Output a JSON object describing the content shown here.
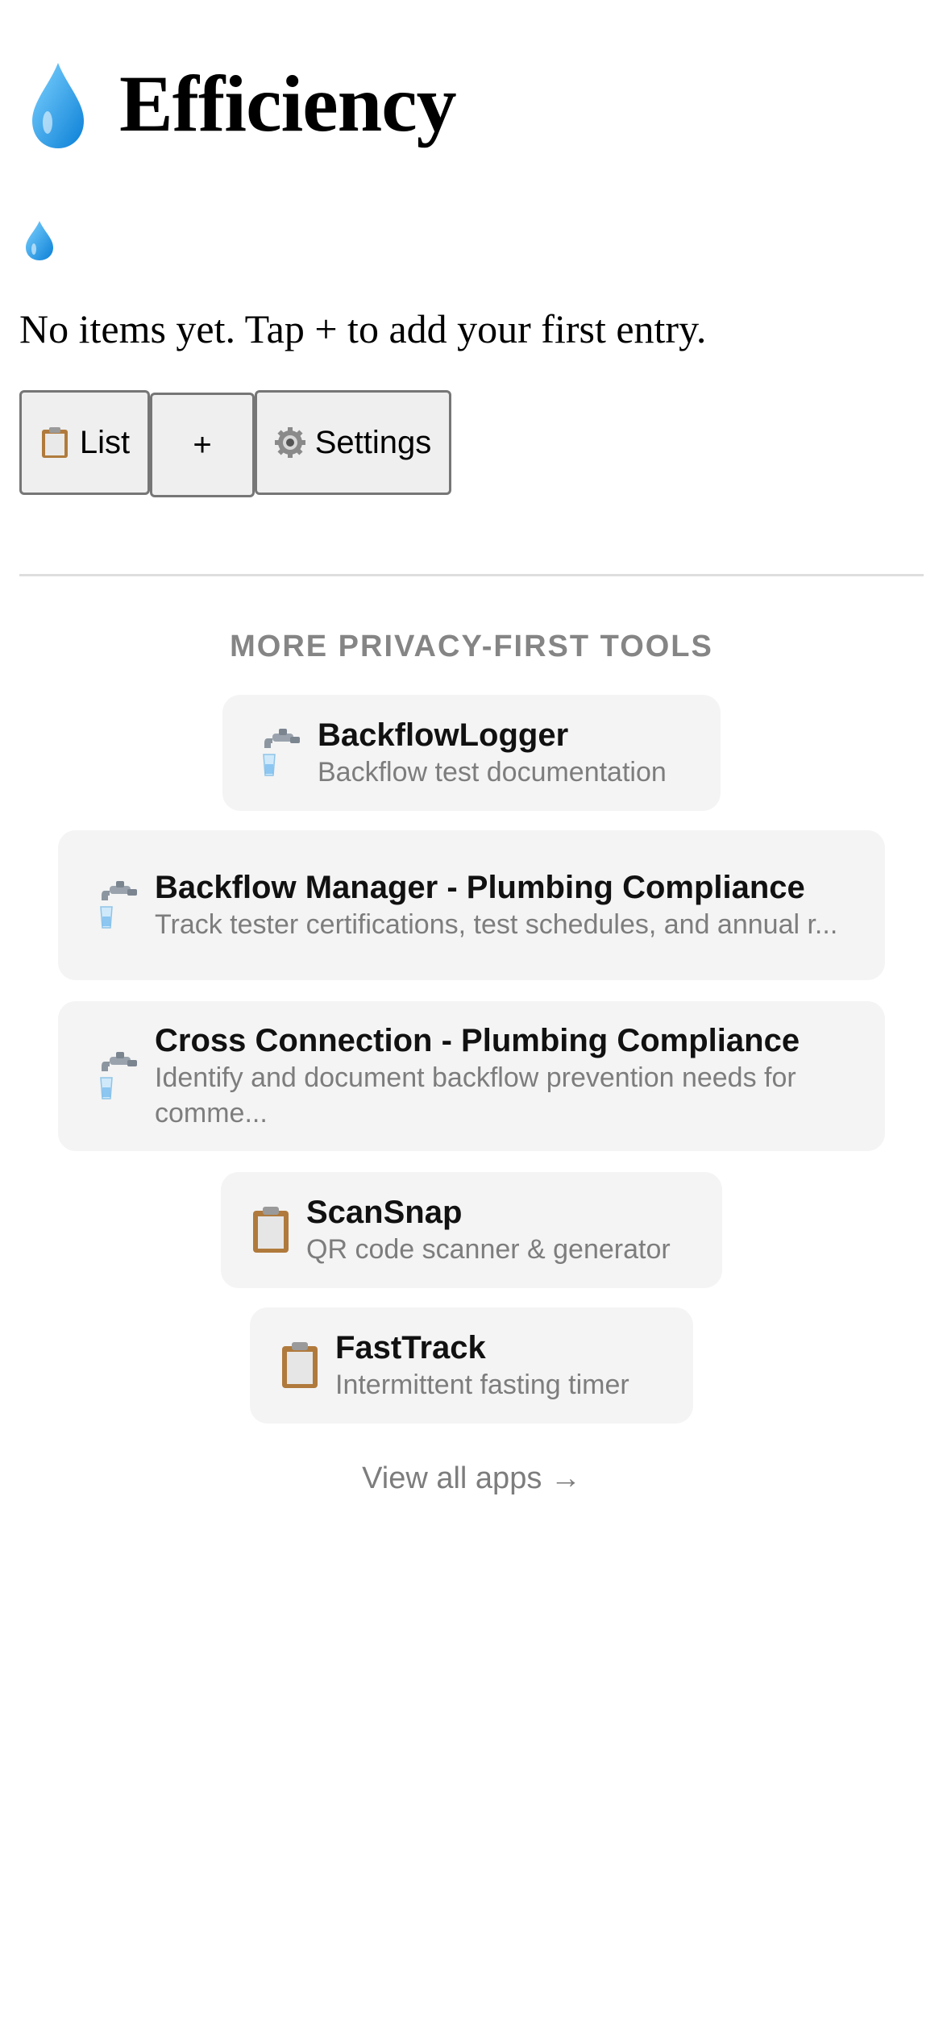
{
  "header": {
    "icon": "water-drop-icon",
    "title": "Efficiency"
  },
  "empty_state": {
    "icon": "water-drop-icon",
    "text": "No items yet. Tap + to add your first entry."
  },
  "buttons": {
    "list_label": "List",
    "list_icon": "clipboard-icon",
    "add_label": "+",
    "settings_label": "Settings",
    "settings_icon": "gear-icon"
  },
  "promo": {
    "heading": "MORE PRIVACY-FIRST TOOLS",
    "apps": [
      {
        "icon": "faucet-icon",
        "title": "BackflowLogger",
        "desc": "Backflow test documentation"
      },
      {
        "icon": "faucet-icon",
        "title": "Backflow Manager - Plumbing Compliance",
        "desc": "Track tester certifications, test schedules, and annual r..."
      },
      {
        "icon": "faucet-icon",
        "title": "Cross Connection - Plumbing Compliance",
        "desc": "Identify and document backflow prevention needs for comme..."
      },
      {
        "icon": "clipboard-icon",
        "title": "ScanSnap",
        "desc": "QR code scanner & generator"
      },
      {
        "icon": "clipboard-icon",
        "title": "FastTrack",
        "desc": "Intermittent fasting timer"
      }
    ],
    "view_all": "View all apps →"
  },
  "colors": {
    "drop_blue": "#1e9be8",
    "card_bg": "#f4f4f4",
    "muted_text": "#7d7d7d",
    "button_bg": "#efefef",
    "button_border": "#767676"
  }
}
